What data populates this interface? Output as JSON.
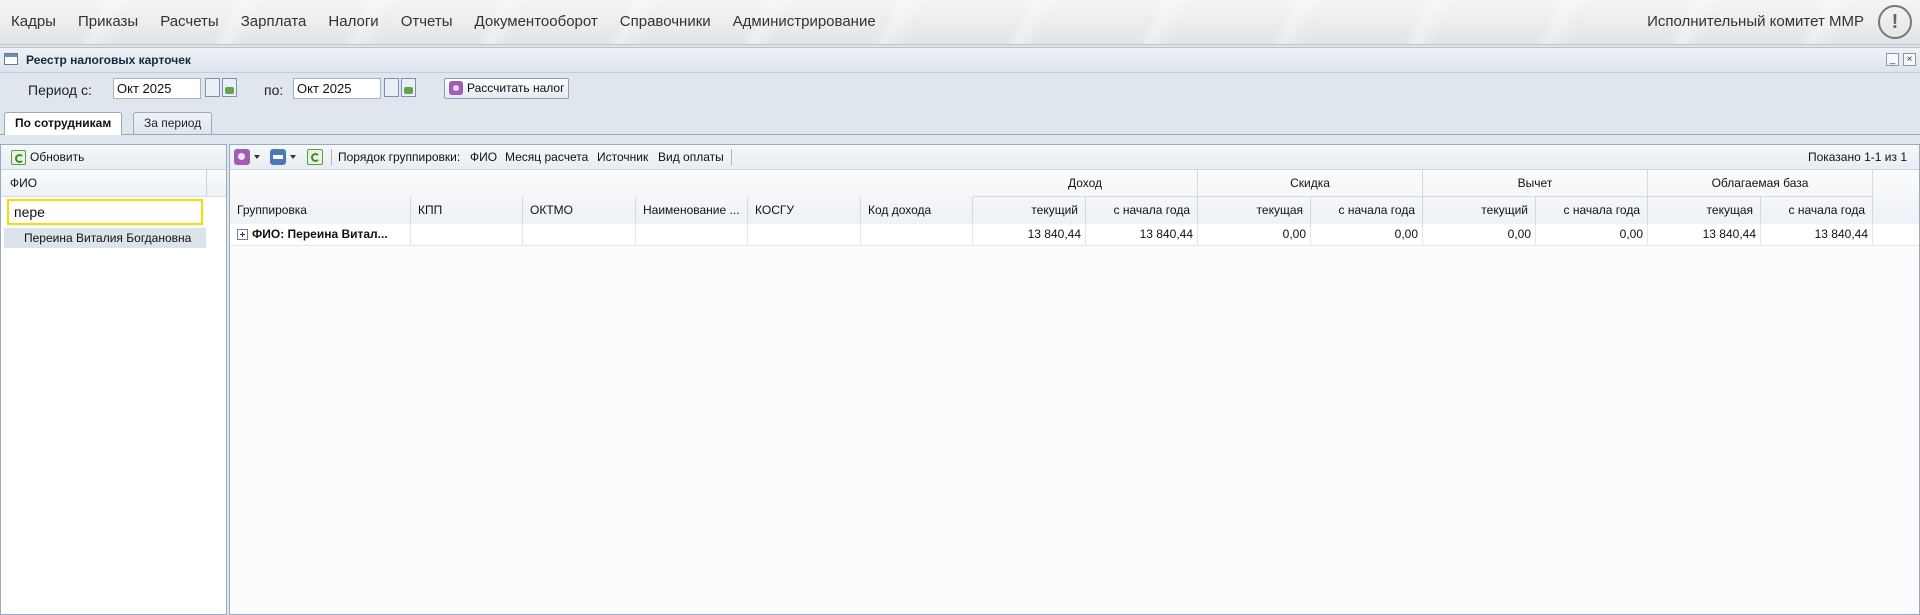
{
  "menu": {
    "items": [
      "Кадры",
      "Приказы",
      "Расчеты",
      "Зарплата",
      "Налоги",
      "Отчеты",
      "Документооборот",
      "Справочники",
      "Администрирование"
    ],
    "org": "Исполнительный комитет ММР",
    "alert_glyph": "!"
  },
  "window": {
    "title": "Реестр налоговых карточек",
    "minimize_glyph": "_",
    "close_glyph": "×"
  },
  "period": {
    "from_label": "Период с:",
    "from_value": "Окт 2025",
    "to_label": "по:",
    "to_value": "Окт 2025",
    "calc_button": "Рассчитать налог"
  },
  "tabs": [
    {
      "label": "По сотрудникам",
      "active": true
    },
    {
      "label": "За период",
      "active": false
    }
  ],
  "left_panel": {
    "refresh_label": "Обновить",
    "column_header": "ФИО",
    "search_value": "пере",
    "rows": [
      "Переина Виталия Богдановна"
    ]
  },
  "right_toolbar": {
    "group_order_label": "Порядок группировки:",
    "group_items": [
      "ФИО",
      "Месяц расчета",
      "Источник",
      "Вид оплаты"
    ],
    "shown": "Показано 1-1 из 1"
  },
  "grid": {
    "columns": [
      "Группировка",
      "КПП",
      "ОКТМО",
      "Наименование ...",
      "КОСГУ",
      "Код дохода"
    ],
    "groups": [
      {
        "label": "Доход",
        "sub": [
          "текущий",
          "с начала года"
        ]
      },
      {
        "label": "Скидка",
        "sub": [
          "текущая",
          "с начала года"
        ]
      },
      {
        "label": "Вычет",
        "sub": [
          "текущий",
          "с начала года"
        ]
      },
      {
        "label": "Облагаемая база",
        "sub": [
          "текущая",
          "с начала года"
        ]
      }
    ],
    "rows": [
      {
        "group": "ФИО: Переина Витал...",
        "kpp": "",
        "oktmo": "",
        "name": "",
        "kosgu": "",
        "income_code": "",
        "values": [
          "13 840,44",
          "13 840,44",
          "0,00",
          "0,00",
          "0,00",
          "0,00",
          "13 840,44",
          "13 840,44"
        ]
      }
    ]
  },
  "colors": {
    "search_border": "#f0e000",
    "accent_purple": "#a05db4",
    "accent_green": "#5a9a48"
  }
}
